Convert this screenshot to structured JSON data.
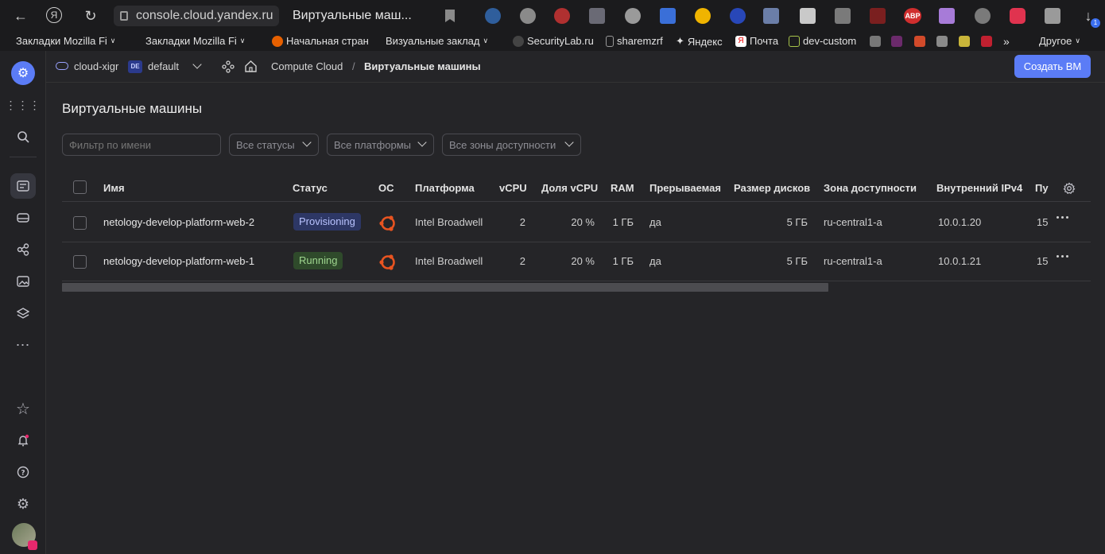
{
  "browser": {
    "url": "console.cloud.yandex.ru",
    "tab_title": "Виртуальные маш...",
    "bookmarks": [
      "Закладки Mozilla Fi",
      "Закладки Mozilla Fi",
      "Начальная стран",
      "Визуальные заклад",
      "SecurityLab.ru",
      "sharemzrf",
      "Яндекс",
      "Почта",
      "dev-custom",
      "Другое"
    ],
    "download_badge": "1",
    "abp_label": "ABP"
  },
  "header": {
    "cloud": "cloud-xigr",
    "folder_badge": "DE",
    "folder": "default",
    "service": "Compute Cloud",
    "separator": "/",
    "page": "Виртуальные машины",
    "create_button": "Создать ВМ"
  },
  "main": {
    "title": "Виртуальные машины",
    "filters": {
      "name_placeholder": "Фильтр по имени",
      "statuses": "Все статусы",
      "platforms": "Все платформы",
      "zones": "Все зоны доступности"
    },
    "columns": [
      "Имя",
      "Статус",
      "ОС",
      "Платформа",
      "vCPU",
      "Доля vCPU",
      "RAM",
      "Прерываемая",
      "Размер дисков",
      "Зона доступности",
      "Внутренний IPv4",
      "Пу"
    ],
    "rows": [
      {
        "name": "netology-develop-platform-web-2",
        "status": "Provisioning",
        "platform": "Intel Broadwell",
        "vcpu": "2",
        "share": "20 %",
        "ram": "1 ГБ",
        "preemptible": "да",
        "disk": "5 ГБ",
        "zone": "ru-central1-a",
        "ipv4": "10.0.1.20",
        "pub": "15"
      },
      {
        "name": "netology-develop-platform-web-1",
        "status": "Running",
        "platform": "Intel Broadwell",
        "vcpu": "2",
        "share": "20 %",
        "ram": "1 ГБ",
        "preemptible": "да",
        "disk": "5 ГБ",
        "zone": "ru-central1-a",
        "ipv4": "10.0.1.21",
        "pub": "15"
      }
    ]
  },
  "colors": {
    "accent": "#5b7cf6",
    "provisioning_bg": "#2d3765",
    "provisioning_fg": "#b9c3ff",
    "running_bg": "#2f4a2b",
    "running_fg": "#9fd68f",
    "ubuntu": "#e95420"
  }
}
